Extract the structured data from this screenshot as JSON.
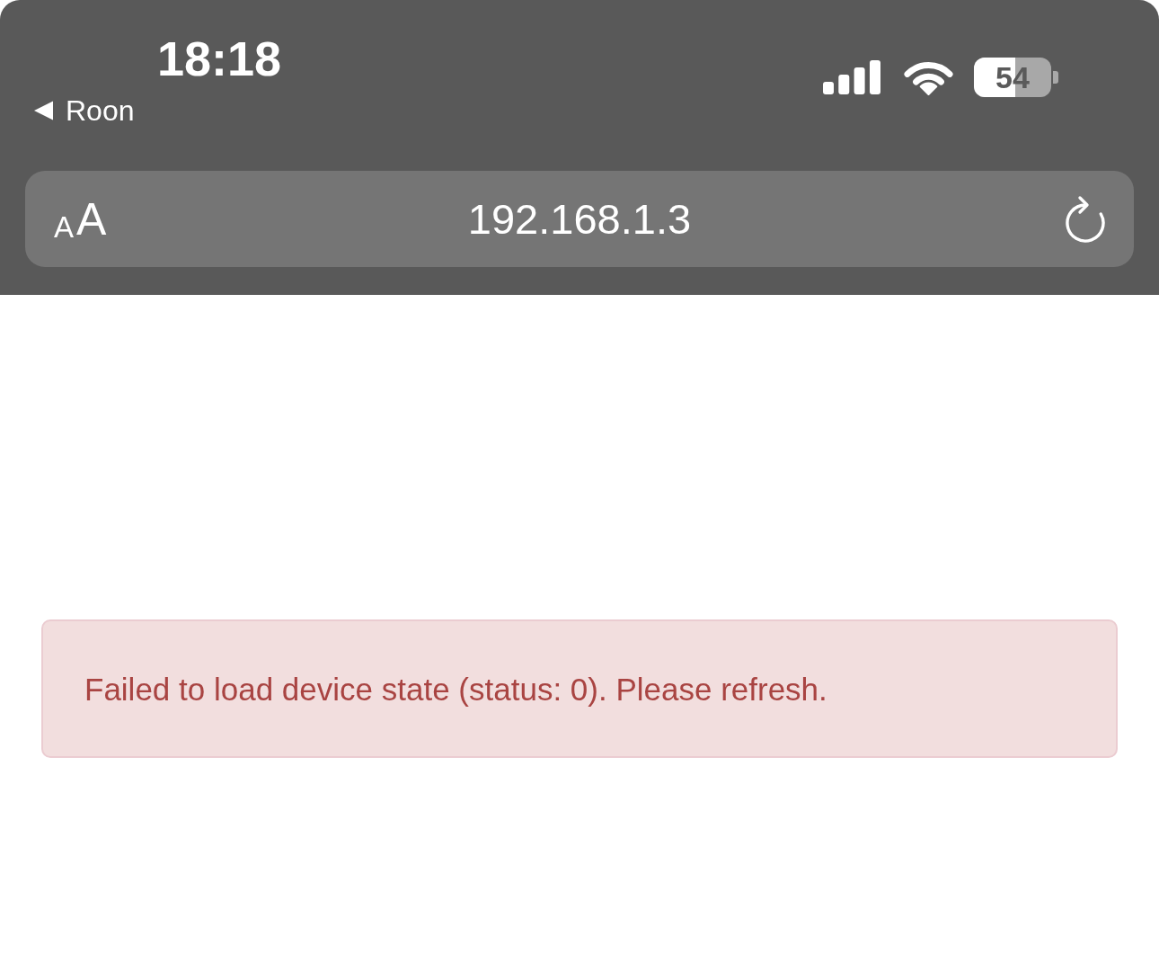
{
  "status_bar": {
    "time": "18:18",
    "back_link": "Roon",
    "battery": {
      "percentage": "54",
      "level": 0.54
    }
  },
  "address_bar": {
    "text_size_button": {
      "small": "A",
      "large": "A"
    },
    "url": "192.168.1.3"
  },
  "alert": {
    "kind": "danger",
    "message": "Failed to load device state (status: 0). Please refresh."
  }
}
